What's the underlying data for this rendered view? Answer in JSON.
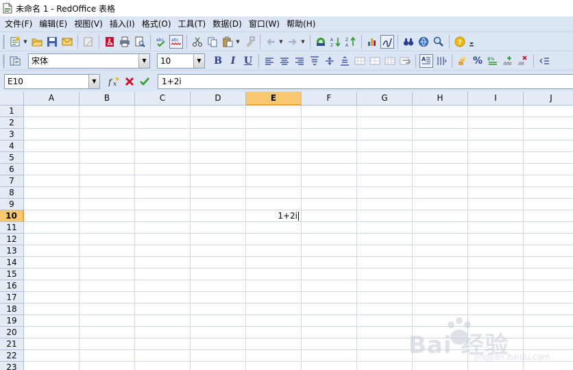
{
  "window": {
    "title": "未命名 1 - RedOffice 表格"
  },
  "menu": [
    "文件(F)",
    "编辑(E)",
    "视图(V)",
    "插入(I)",
    "格式(O)",
    "工具(T)",
    "数据(D)",
    "窗口(W)",
    "帮助(H)"
  ],
  "format": {
    "font_name": "宋体",
    "font_size": "10"
  },
  "formula_bar": {
    "cell_ref": "E10",
    "formula": "1+2i"
  },
  "grid": {
    "columns": [
      "A",
      "B",
      "C",
      "D",
      "E",
      "F",
      "G",
      "H",
      "I",
      "J"
    ],
    "rows": [
      "1",
      "2",
      "3",
      "4",
      "5",
      "6",
      "7",
      "8",
      "9",
      "10",
      "11",
      "12",
      "13",
      "14",
      "15",
      "16",
      "17",
      "18",
      "19",
      "20",
      "21",
      "22",
      "23"
    ],
    "active_column": "E",
    "active_row": "10",
    "cells": {
      "E10": "1+2i"
    }
  },
  "watermark": {
    "brand": "Bai 经验",
    "site": "jingyan.baidu.com"
  },
  "colors": {
    "chrome": "#dbe5f3",
    "header": "#e6ecf6",
    "active_header": "#f8c870",
    "gridline": "#d0d7e5"
  }
}
